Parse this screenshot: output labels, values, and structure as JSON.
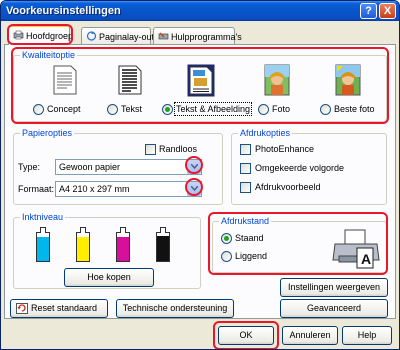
{
  "window": {
    "title": "Voorkeursinstellingen",
    "help_label": "?",
    "close_label": "X"
  },
  "tabs": [
    {
      "label": "Hoofdgroep",
      "active": true
    },
    {
      "label": "Paginalay-out",
      "active": false
    },
    {
      "label": "Hulpprogramma's",
      "active": false
    }
  ],
  "quality": {
    "group_label": "Kwaliteitoptie",
    "options": [
      {
        "label": "Concept",
        "selected": false,
        "icon": "draft-page-icon"
      },
      {
        "label": "Tekst",
        "selected": false,
        "icon": "text-page-icon"
      },
      {
        "label": "Tekst & Afbeelding",
        "selected": true,
        "icon": "text-image-page-icon"
      },
      {
        "label": "Foto",
        "selected": false,
        "icon": "photo-icon"
      },
      {
        "label": "Beste foto",
        "selected": false,
        "icon": "best-photo-icon"
      }
    ]
  },
  "paper": {
    "group_label": "Papieropties",
    "borderless_label": "Randloos",
    "type_label": "Type:",
    "type_value": "Gewoon papier",
    "format_label": "Formaat:",
    "format_value": "A4 210 x 297 mm"
  },
  "print_options": {
    "group_label": "Afdrukopties",
    "items": [
      {
        "label": "PhotoEnhance",
        "checked": false
      },
      {
        "label": "Omgekeerde volgorde",
        "checked": false
      },
      {
        "label": "Afdrukvoorbeeld",
        "checked": false
      }
    ]
  },
  "ink": {
    "group_label": "Inktniveau",
    "colors": [
      "#00b7eb",
      "#ffee00",
      "#d6109b",
      "#111111"
    ],
    "levels": [
      0.85,
      0.85,
      0.85,
      0.9
    ],
    "buy_button": "Hoe kopen"
  },
  "orientation": {
    "group_label": "Afdrukstand",
    "options": [
      {
        "label": "Staand",
        "selected": true
      },
      {
        "label": "Liggend",
        "selected": false
      }
    ]
  },
  "bottom_buttons": {
    "reset": "Reset standaard",
    "support": "Technische ondersteuning",
    "show_settings": "Instellingen weergeven",
    "advanced": "Geavanceerd"
  },
  "dialog_buttons": {
    "ok": "OK",
    "cancel": "Annuleren",
    "help": "Help"
  },
  "colors": {
    "accent_red": "#e8182a",
    "group_label_blue": "#0046d5",
    "titlebar_blue": "#0a5fd8"
  }
}
